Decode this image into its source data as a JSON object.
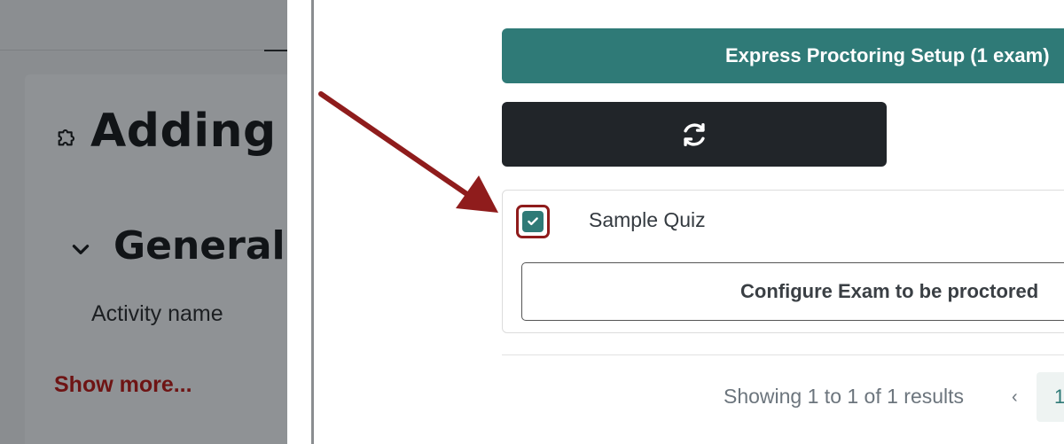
{
  "left_page": {
    "title": "Adding",
    "section": "General",
    "field_label": "Activity name",
    "show_more": "Show more..."
  },
  "proctoring": {
    "express_setup_label": "Express Proctoring Setup (1 exam)",
    "refresh_icon": "refresh-icon",
    "exam": {
      "name": "Sample Quiz",
      "checked": true,
      "configure_label": "Configure Exam to be proctored"
    },
    "pagination": {
      "results_text": "Showing 1 to 1 of 1 results",
      "prev": "‹",
      "current_page": "1"
    }
  },
  "colors": {
    "accent": "#2f7a77",
    "dark_button": "#212529",
    "annotation": "#8f1c1c"
  }
}
